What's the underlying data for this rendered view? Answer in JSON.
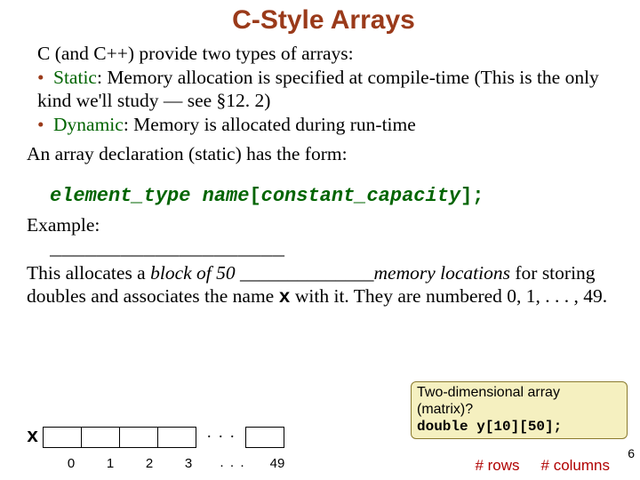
{
  "title": "C-Style Arrays",
  "intro": "C (and C++) provide two types of arrays:",
  "bullet1_kw": "Static",
  "bullet1_rest": ":  Memory allocation is specified at compile-time (This is the only kind we'll study — see §12. 2)",
  "bullet2_kw": "Dynamic",
  "bullet2_rest": ":  Memory is allocated during run-time",
  "decl_lead": "An array declaration (static) has the form:",
  "decl_type": "element_type",
  "decl_name": "name",
  "decl_lb": "[",
  "decl_cap": "constant_capacity",
  "decl_rb": "];",
  "example_label": "Example:",
  "blank_underscores": "____________________",
  "explain_1a": "This allocates a ",
  "explain_1b_italic": "block of 50",
  "explain_1c": " ______________",
  "explain_1d_italic": "memory locations",
  "explain_1e": " for storing doubles and associates the name ",
  "explain_1f_mono": "x",
  "explain_1g": " with it.  They are numbered 0, 1, . . . , 49.",
  "array_label": "x",
  "indices": [
    "0",
    "1",
    "2",
    "3"
  ],
  "idx_dots": ". . .",
  "idx_last": "49",
  "cell_dots": ". . .",
  "callout_l1": "Two-dimensional array",
  "callout_l2": "(matrix)?",
  "callout_code": "double y[10][50];",
  "nrows": "# rows",
  "ncols": "# columns",
  "pagenum": "6"
}
